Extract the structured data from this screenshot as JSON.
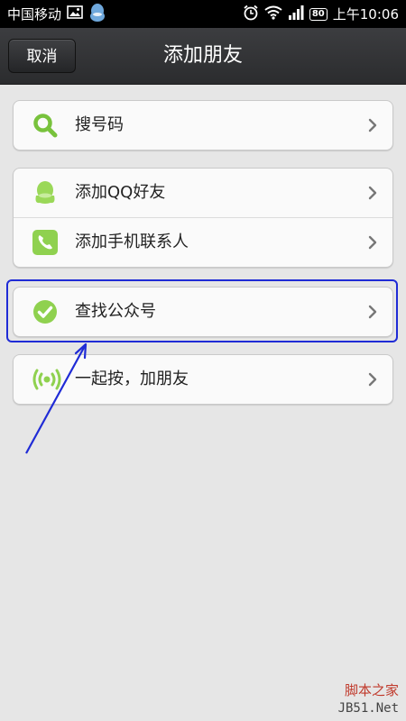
{
  "status_bar": {
    "carrier": "中国移动",
    "battery": "80",
    "time": "上午10:06"
  },
  "header": {
    "cancel_label": "取消",
    "title": "添加朋友"
  },
  "menu": {
    "search_number": "搜号码",
    "add_qq_friends": "添加QQ好友",
    "add_phone_contacts": "添加手机联系人",
    "find_public_accounts": "查找公众号",
    "shake_together": "一起按，加朋友"
  },
  "watermark": {
    "line1": "脚本之家",
    "line2": "JB51.Net"
  },
  "colors": {
    "accent_green": "#7dc93b",
    "annotation_blue": "#1f2bd6",
    "title_bar": "#2f3032"
  }
}
